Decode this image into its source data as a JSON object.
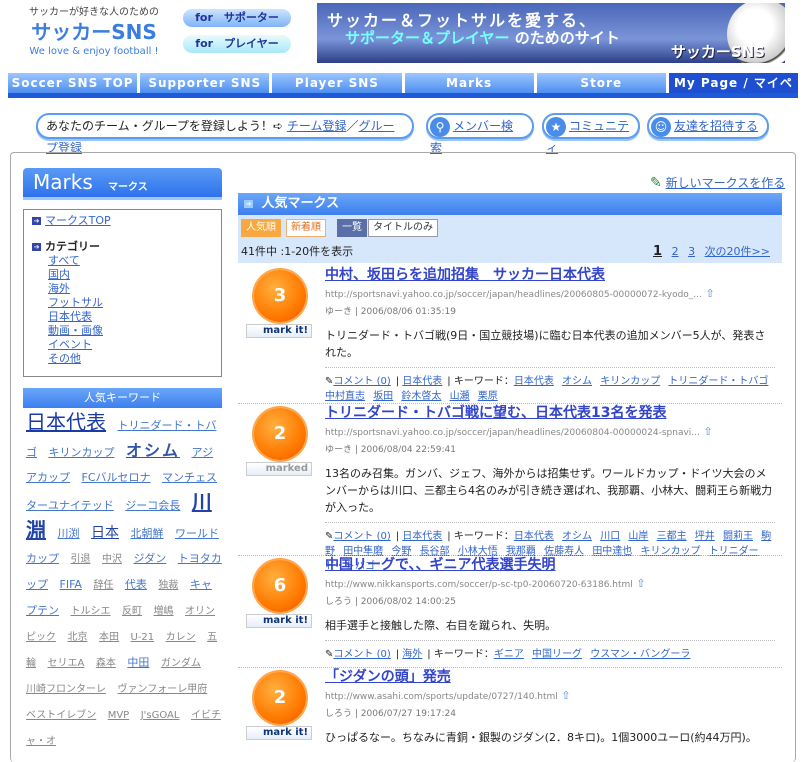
{
  "header": {
    "tagline": "サッカーが好きな人のための",
    "logo": "サッカーSNS",
    "slogan": "We love & enjoy football !",
    "for_supporter": "for　サポーター",
    "for_player": "for　プレイヤー",
    "banner": {
      "line1": "サッカー＆フットサルを愛する、",
      "line2a": "サポーター＆プレイヤー",
      "line2b": " のためのサイト",
      "brand": "サッカーSNS"
    }
  },
  "nav": [
    "Soccer SNS  TOP",
    "Supporter SNS",
    "Player SNS",
    "Marks",
    "Store",
    "My Page / マイページ"
  ],
  "invite": {
    "text": "あなたのチーム・グループを登録しよう！",
    "arrow": "➪",
    "team": "チーム登録",
    "slash": "／",
    "group": "グループ登録",
    "member_search": "メンバー検索",
    "community": "コミュニティ",
    "invite_friends": "友達を招待する"
  },
  "sidebar": {
    "title": "Marks",
    "subtitle": "マークス",
    "top_link": "マークスTOP",
    "category_label": "カテゴリー",
    "categories": [
      "すべて",
      "国内",
      "海外",
      "フットサル",
      "日本代表",
      "動画・画像",
      "イベント",
      "その他"
    ],
    "keywords_title": "人気キーワード",
    "keywords": [
      {
        "w": "日本代表",
        "t": "k1"
      },
      {
        "w": "トリニダード・トバゴ",
        "t": "k4"
      },
      {
        "w": "キリンカップ",
        "t": "k4"
      },
      {
        "w": "オシム",
        "t": "k2"
      },
      {
        "w": "アジアカップ",
        "t": "k4"
      },
      {
        "w": "FCバルセロナ",
        "t": "k4"
      },
      {
        "w": "マンチェスターユナイテッド",
        "t": "k4"
      },
      {
        "w": "ジーコ会長",
        "t": "k4"
      },
      {
        "w": "川淵",
        "t": "kl"
      },
      {
        "w": "川渕",
        "t": "k4"
      },
      {
        "w": "日本",
        "t": "k3"
      },
      {
        "w": "北朝鮮",
        "t": "k4"
      },
      {
        "w": "ワールドカップ",
        "t": "k4"
      },
      {
        "w": "引退",
        "t": "k5"
      },
      {
        "w": "中沢",
        "t": "k5"
      },
      {
        "w": "ジダン",
        "t": "k4"
      },
      {
        "w": "トヨタカップ",
        "t": "k4"
      },
      {
        "w": "FIFA",
        "t": "k4"
      },
      {
        "w": "辞任",
        "t": "k5"
      },
      {
        "w": "代表",
        "t": "k4"
      },
      {
        "w": "独裁",
        "t": "k5"
      },
      {
        "w": "キャプテン",
        "t": "k4"
      },
      {
        "w": "トルシエ",
        "t": "k5"
      },
      {
        "w": "反町",
        "t": "k5"
      },
      {
        "w": "増嶋",
        "t": "k5"
      },
      {
        "w": "オリンピック",
        "t": "k5"
      },
      {
        "w": "北京",
        "t": "k5"
      },
      {
        "w": "本田",
        "t": "k5"
      },
      {
        "w": "U-21",
        "t": "k5"
      },
      {
        "w": "カレン",
        "t": "k5"
      },
      {
        "w": "五輪",
        "t": "k5"
      },
      {
        "w": "セリエA",
        "t": "k5"
      },
      {
        "w": "森本",
        "t": "k5"
      },
      {
        "w": "中田",
        "t": "k4"
      },
      {
        "w": "ガンダム",
        "t": "k5"
      },
      {
        "w": "川崎フロンターレ",
        "t": "k5"
      },
      {
        "w": "ヴァンフォーレ甲府",
        "t": "k5"
      },
      {
        "w": "ベストイレブン",
        "t": "k5"
      },
      {
        "w": "MVP",
        "t": "k5"
      },
      {
        "w": "J'sGOAL",
        "t": "k5"
      },
      {
        "w": "イビチャ・オ",
        "t": "k5"
      }
    ]
  },
  "main": {
    "new_mark": "新しいマークスを作る",
    "section_title": "人気マークス",
    "tabs": {
      "popular": "人気順",
      "newest": "新着順",
      "list": "一覧",
      "title_only": "タイトルのみ"
    },
    "count": "41件中 :1-20件を表示",
    "pages": [
      "1",
      "2",
      "3"
    ],
    "next": "次の20件>>",
    "comment_label": "コメント (0)",
    "keyword_label": "キーワード：",
    "items": [
      {
        "count": "3",
        "label": "mark it!",
        "title": "中村、坂田らを追加招集　サッカー日本代表",
        "url": "http://sportsnavi.yahoo.co.jp/soccer/japan/headlines/20060805-00000072-kyodo_...",
        "user": "ゆーき",
        "date": "2006/08/06 01:35:19",
        "desc": "トリニダード・トバゴ戦(9日・国立競技場)に臨む日本代表の追加メンバー5人が、発表された。",
        "category": "日本代表",
        "keywords": [
          "日本代表",
          "オシム",
          "キリンカップ",
          "トリニダード・トバゴ",
          "中村直志",
          "坂田",
          "鈴木啓太",
          "山瀬",
          "栗原"
        ]
      },
      {
        "count": "2",
        "label": "marked",
        "title": "トリニダード・トバゴ戦に望む、日本代表13名を発表",
        "url": "http://sportsnavi.yahoo.co.jp/soccer/japan/headlines/20060804-00000024-spnavi...",
        "user": "ゆーき",
        "date": "2006/08/04 22:59:41",
        "desc": "13名のみ召集。ガンバ、ジェフ、海外からは招集せず。ワールドカップ・ドイツ大会のメンバーからは川口、三都主ら4名のみが引き続き選ばれ、我那覇、小林大、闘莉王ら新戦力が入った。",
        "category": "日本代表",
        "keywords": [
          "日本代表",
          "オシム",
          "川口",
          "山岸",
          "三都主",
          "坪井",
          "闘莉王",
          "駒野",
          "田中隼磨",
          "今野",
          "長谷部",
          "小林大悟",
          "我那覇",
          "佐藤寿人",
          "田中達也",
          "キリンカップ",
          "トリニダード・トバゴ"
        ]
      },
      {
        "count": "6",
        "label": "mark it!",
        "title": "中国リーグで、、ギニア代表選手失明",
        "url": "http://www.nikkansports.com/soccer/p-sc-tp0-20060720-63186.html",
        "user": "しろう",
        "date": "2006/08/02 14:00:25",
        "desc": "相手選手と接触した際、右目を蹴られ、失明。",
        "category": "海外",
        "keywords": [
          "ギニア",
          "中国リーグ",
          "ウスマン・バングーラ"
        ]
      },
      {
        "count": "2",
        "label": "mark it!",
        "title": "「ジダンの頭」発売",
        "url": "http://www.asahi.com/sports/update/0727/140.html",
        "user": "しろう",
        "date": "2006/07/27 19:17:24",
        "desc": "ひっぱるなー。ちなみに青銅・銀製のジダン(2．8キロ)。1個3000ユーロ(約44万円)。",
        "category": "",
        "keywords": []
      }
    ]
  }
}
